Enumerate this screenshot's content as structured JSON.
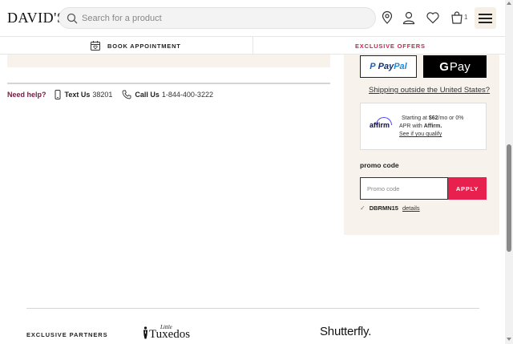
{
  "header": {
    "logo": "DAVID'S",
    "search_placeholder": "Search for a product",
    "bag_count": "1"
  },
  "subnav": {
    "book_appointment": "BOOK APPOINTMENT",
    "exclusive_offers": "EXCLUSIVE OFFERS"
  },
  "help": {
    "need_help": "Need help?",
    "text_us_label": "Text Us",
    "text_us_value": "38201",
    "call_us_label": "Call Us",
    "call_us_value": "1-844-400-3222"
  },
  "payment": {
    "paypal_pay": "Pay",
    "paypal_pal": "Pal",
    "gpay_label": "Pay",
    "shipping_link": "Shipping outside the United States?"
  },
  "affirm": {
    "logo": "affirm",
    "line1_prefix": "Starting at ",
    "line1_amount": "$62",
    "line1_suffix": "/mo or 0%",
    "line2_prefix": "APR with ",
    "line2_brand": "Affirm.",
    "link": "See if you qualify"
  },
  "promo": {
    "label": "promo code",
    "placeholder": "Promo code",
    "apply": "APPLY",
    "applied_code": "DBRMN15",
    "details": "details"
  },
  "footer": {
    "partners_label": "EXCLUSIVE PARTNERS",
    "little_tuxedos_small": "Little",
    "little_tuxedos_main": "Tuxedos",
    "shutterfly": "Shutterfly."
  },
  "colors": {
    "accent_pink": "#e8204e",
    "offer_pink": "#c8274f",
    "need_help": "#6c1f3e",
    "panel_beige": "#f7f3ec"
  }
}
